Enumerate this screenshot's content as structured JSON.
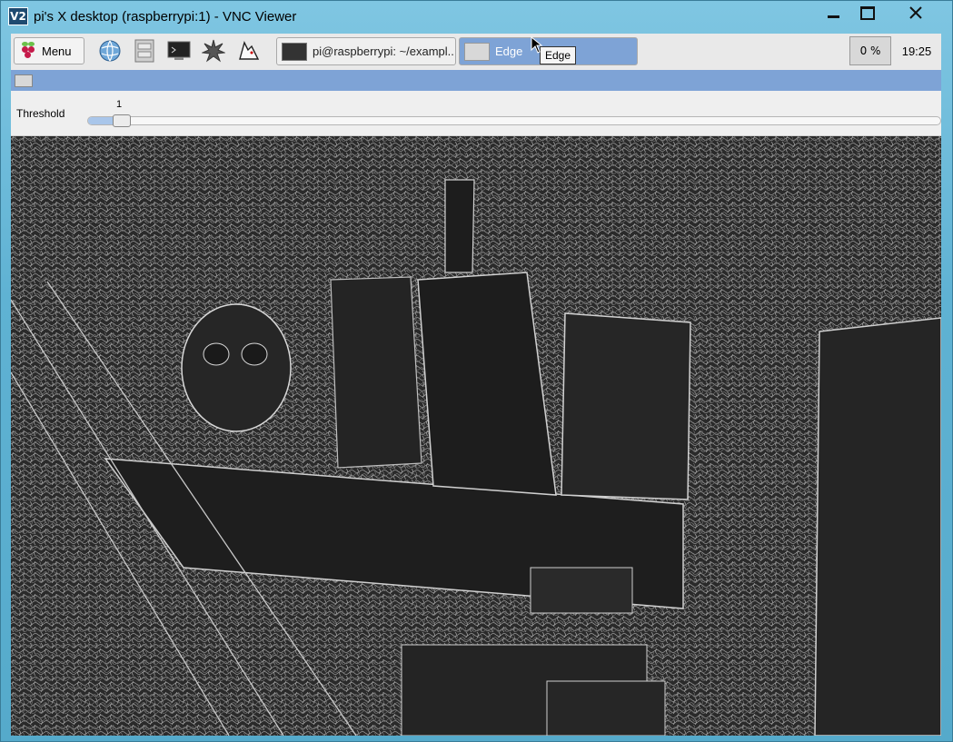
{
  "window": {
    "title": "pi's X desktop (raspberrypi:1) - VNC Viewer",
    "app_icon_text": "V2"
  },
  "panel": {
    "menu_label": "Menu",
    "tasks": [
      {
        "label": "pi@raspberrypi: ~/exampl..."
      },
      {
        "label": "Edge"
      }
    ],
    "cpu_label": "0 %",
    "clock": "19:25",
    "tooltip": "Edge"
  },
  "edge_window": {
    "threshold_label": "Threshold",
    "threshold_value": "1",
    "threshold_fraction": 0.03
  },
  "colors": {
    "taskbar_active": "#7ea3d6",
    "vnc_frame": "#5fb2d3"
  }
}
